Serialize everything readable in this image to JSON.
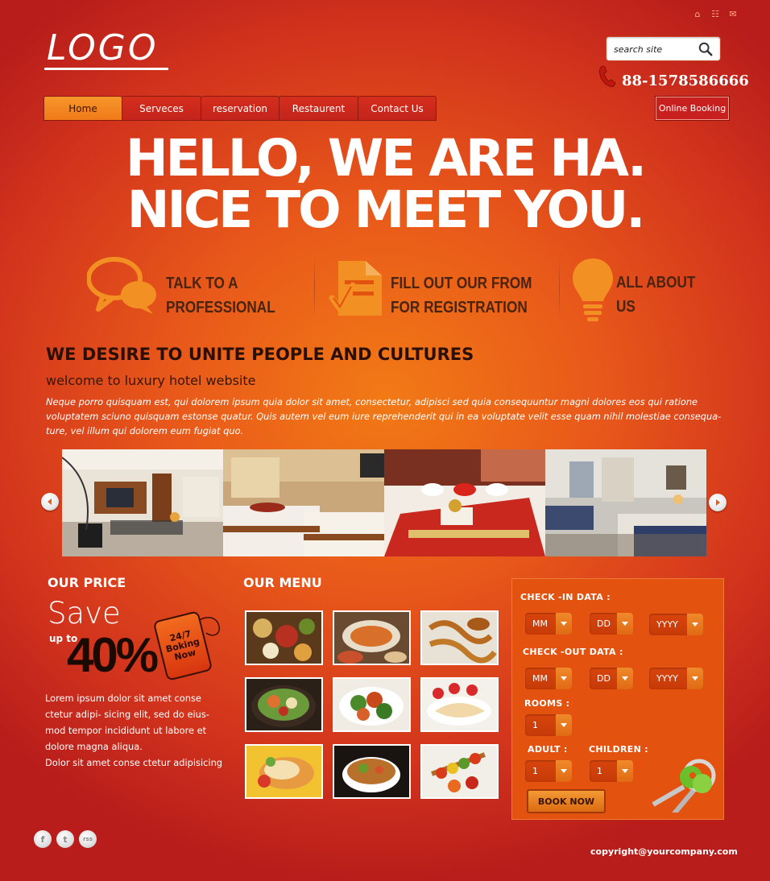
{
  "header": {
    "logo": "LOGO",
    "search_placeholder": "search site",
    "phone": "88-1578586666",
    "online_booking": "Online Booking"
  },
  "nav": [
    "Home",
    "Serveces",
    "reservation",
    "Restaurent",
    "Contact Us"
  ],
  "hero": {
    "line1": "HELLO, WE ARE HA.",
    "line2": "NICE TO MEET YOU."
  },
  "features": [
    {
      "icon": "chat-bubbles-icon",
      "line1": "TALK TO A",
      "line2": "PROFESSIONAL"
    },
    {
      "icon": "form-check-icon",
      "line1": "FILL OUT OUR FROM",
      "line2": "FOR REGISTRATION"
    },
    {
      "icon": "lightbulb-icon",
      "line1": "ALL ABOUT",
      "line2": "US"
    }
  ],
  "intro": {
    "tagline": "WE DESIRE TO UNITE PEOPLE AND CULTURES",
    "welcome": "welcome to luxury hotel website",
    "body": "Neque porro quisquam est, qui dolorem ipsum quia dolor sit amet, consectetur, adipisci sed quia consequuntur magni dolores eos qui ratione voluptatem sciuno quisquam estonse quatur. Quis autem vel eum iure reprehenderit qui in ea voluptate velit esse quam nihil molestiae consequa-ture, vel illum qui dolorem eum fugiat quo."
  },
  "price": {
    "title": "OUR PRICE",
    "save": "Save",
    "upto": "up to",
    "percent": "40%",
    "tag_line1": "24/7",
    "tag_line2": "Boking",
    "tag_line3": "Now",
    "body_lines": [
      "Lorem ipsum dolor sit amet conse",
      "ctetur adipi- sicing elit, sed do eius-",
      "mod tempor incididunt ut labore et",
      "dolore magna aliqua.",
      "Dolor sit amet conse ctetur adipisicing"
    ]
  },
  "menu": {
    "title": "OUR MENU"
  },
  "booking": {
    "checkin_label": "CHECK -IN DATA :",
    "checkout_label": "CHECK -OUT DATA :",
    "rooms_label": "ROOMS :",
    "adult_label": "ADULT :",
    "children_label": "CHILDREN :",
    "mm": "MM",
    "dd": "DD",
    "yyyy": "YYYY",
    "rooms_value": "1",
    "adult_value": "1",
    "children_value": "1",
    "book_now": "BOOK NOW"
  },
  "footer": {
    "social": [
      "f",
      "t",
      "rss"
    ],
    "copyright": "copyright@yourcompany.com"
  },
  "colors": {
    "accent": "#ef7a18",
    "dark_text": "#2a0f05",
    "booking_panel": "#e4520f"
  }
}
